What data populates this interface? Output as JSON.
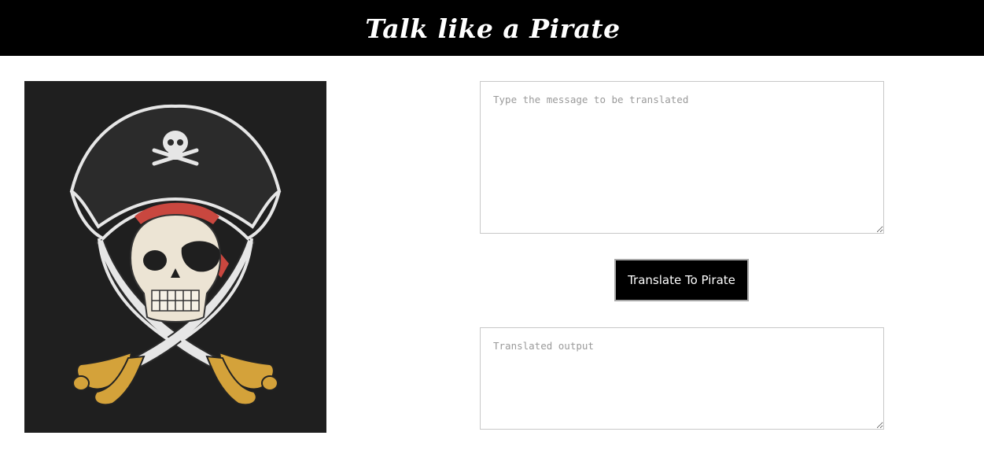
{
  "header": {
    "title": "Talk like a Pirate"
  },
  "image": {
    "icon": "pirate-skull-icon",
    "background_color": "#1f1f1f"
  },
  "translator": {
    "input_placeholder": "Type the message to be translated",
    "input_value": "",
    "button_label": "Translate To Pirate",
    "output_placeholder": "Translated output",
    "output_value": ""
  },
  "colors": {
    "header_bg": "#000000",
    "header_text": "#ffffff",
    "button_bg": "#000000",
    "button_text": "#ffffff",
    "bandana_red": "#c9473f",
    "hilt_gold": "#d4a23a"
  }
}
